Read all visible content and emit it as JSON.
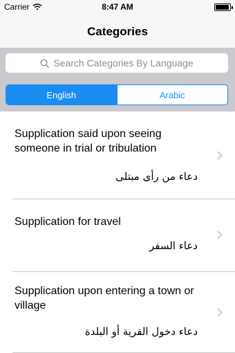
{
  "status_bar": {
    "carrier": "Carrier",
    "time": "8:47 AM",
    "battery_level": 0.95
  },
  "nav": {
    "title": "Categories"
  },
  "search": {
    "placeholder": "Search Categories By Language"
  },
  "segments": {
    "english": "English",
    "arabic": "Arabic",
    "selected": "English"
  },
  "categories": [
    {
      "title": "Supplication said upon seeing someone in trial or tribulation",
      "arabic": "دعاء من رأى مبتلى"
    },
    {
      "title": "Supplication for travel",
      "arabic": "دعاء السفر"
    },
    {
      "title": "Supplication upon entering a town or village",
      "arabic": "دعاء دخول القرية أو البلدة"
    }
  ]
}
